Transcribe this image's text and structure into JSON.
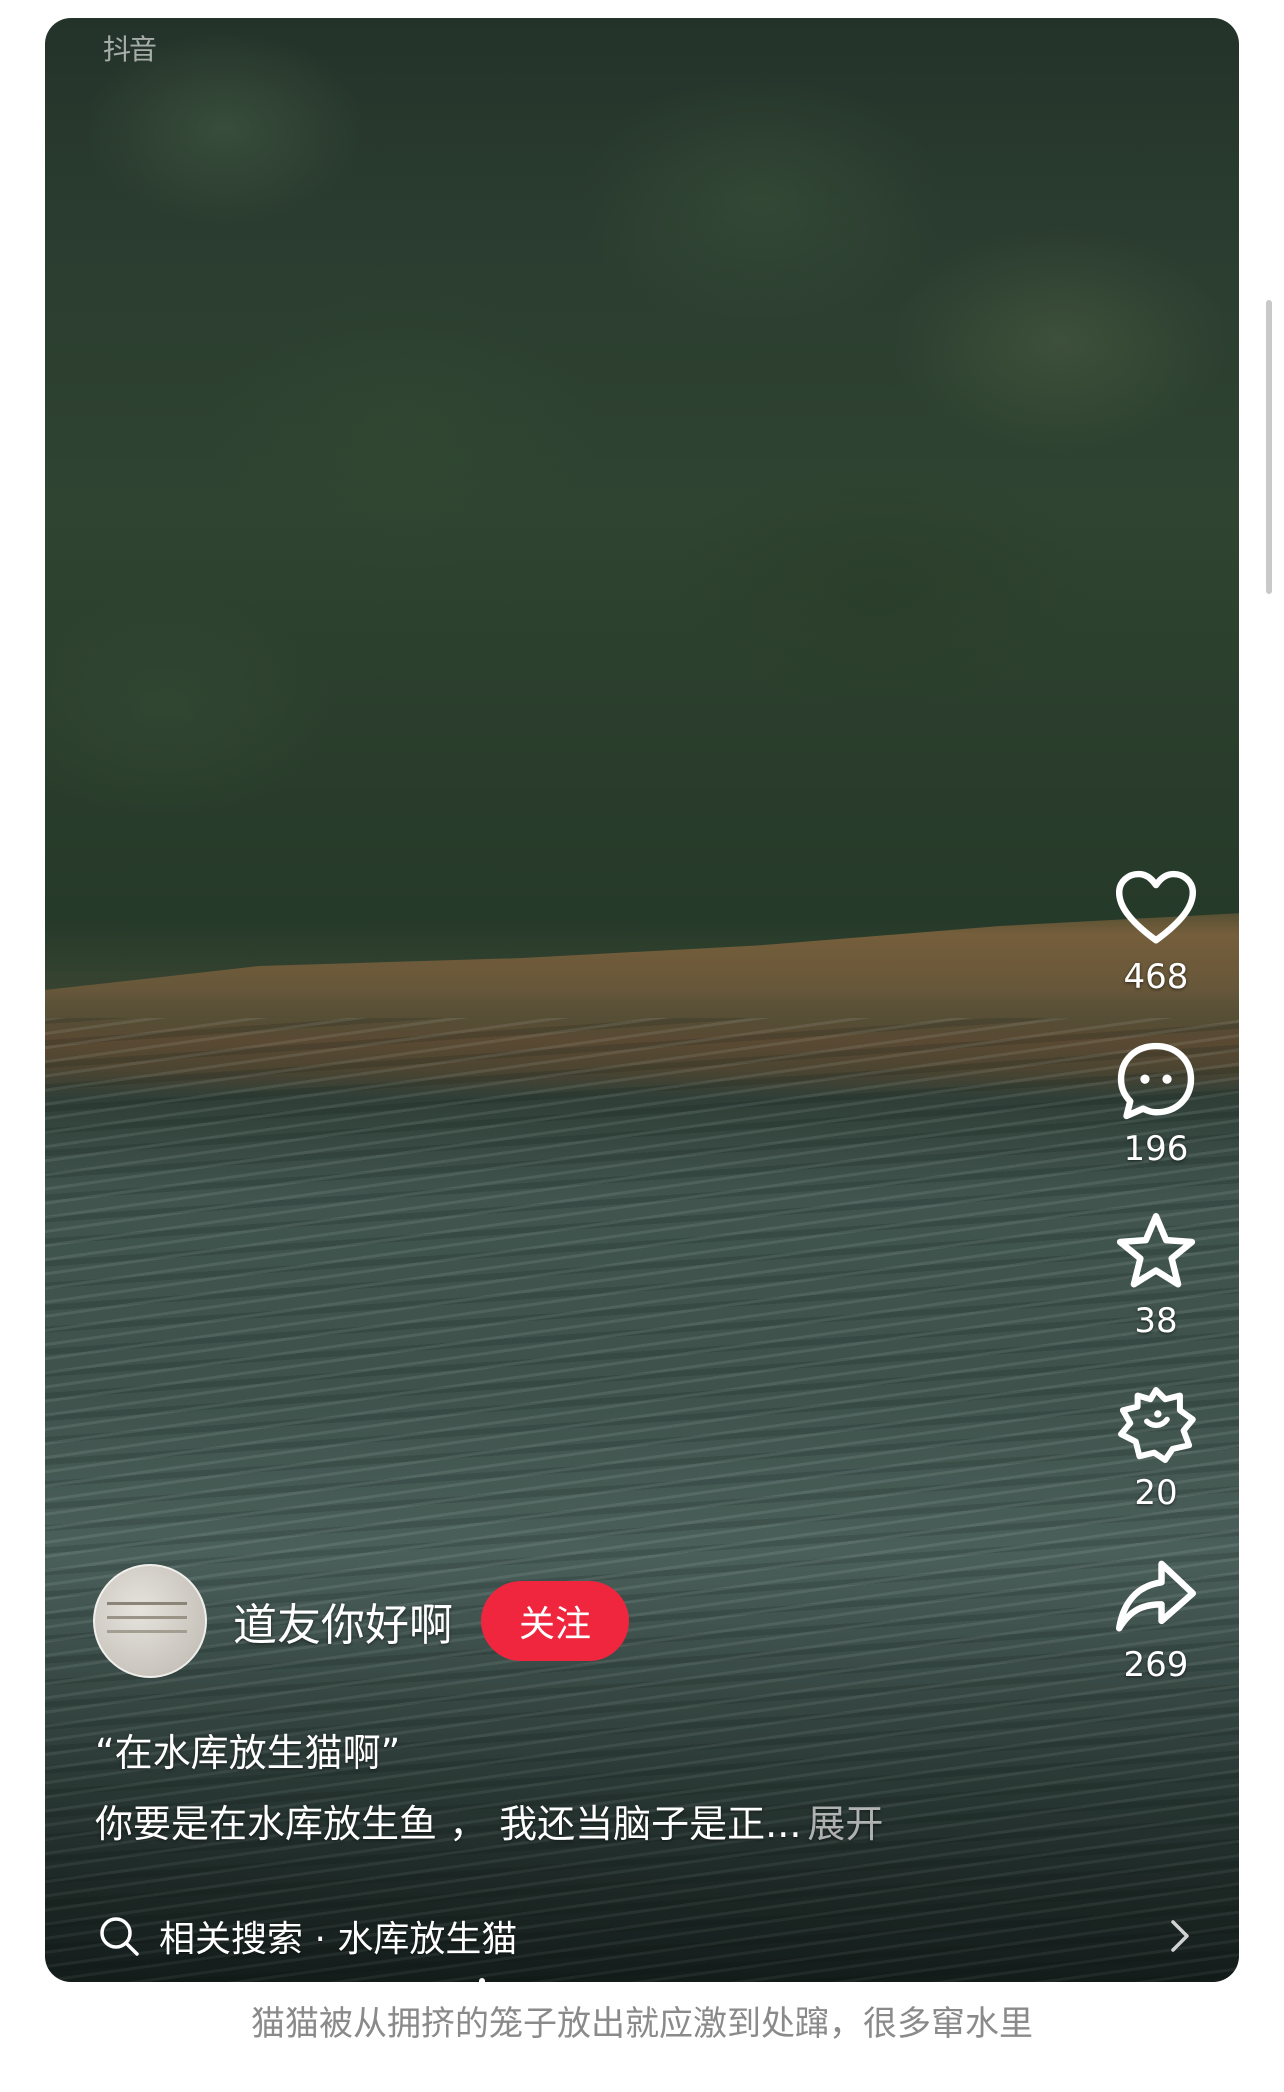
{
  "video": {
    "watermark": "抖音"
  },
  "actions": {
    "like_count": "468",
    "comment_count": "196",
    "favorite_count": "38",
    "share_friend_count": "20",
    "share_count": "269"
  },
  "author": {
    "name": "道友你好啊",
    "follow_label": "关注"
  },
  "caption": {
    "title": "“在水库放生猫啊”",
    "description": "你要是在水库放生鱼 ， 我还当脑子是正...",
    "expand_label": "展开"
  },
  "related_search": {
    "label": "相关搜索 · 水库放生猫"
  },
  "post_text": "猫猫被从拥挤的笼子放出就应激到处蹿，很多窜水里",
  "colors": {
    "follow_button": "#f0263f",
    "icon_white": "#ffffff"
  },
  "icons": [
    "heart-icon",
    "comment-icon",
    "star-icon",
    "share-friend-icon",
    "share-arrow-icon",
    "search-icon",
    "chevron-right-icon"
  ]
}
